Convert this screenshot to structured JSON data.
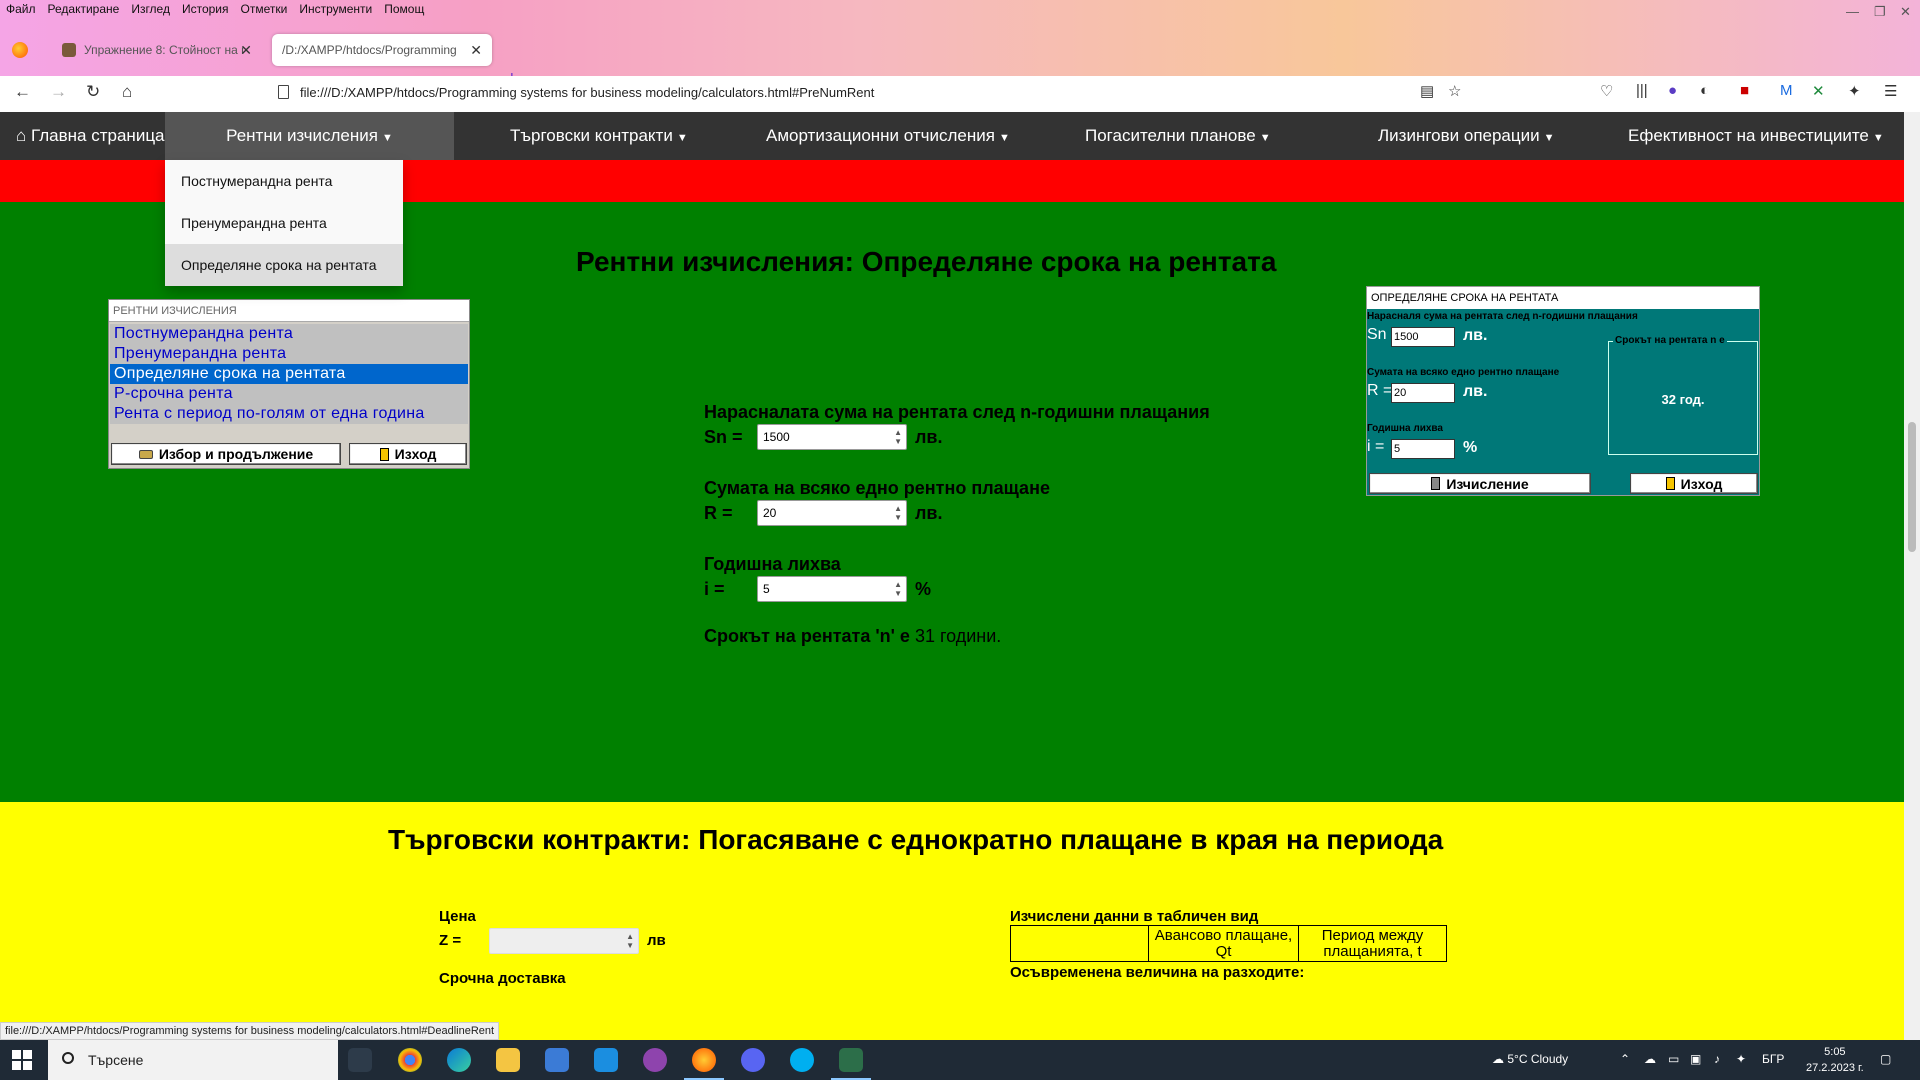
{
  "browser": {
    "menu": [
      "Файл",
      "Редактиране",
      "Изглед",
      "История",
      "Отметки",
      "Инструменти",
      "Помощ"
    ],
    "tabs": [
      {
        "title": "Упражнение 8: Стойност на п"
      },
      {
        "title": "/D:/XAMPP/htdocs/Programming"
      }
    ],
    "url": "file:///D:/XAMPP/htdocs/Programming systems for business modeling/calculators.html#PreNumRent",
    "status_link": "file:///D:/XAMPP/htdocs/Programming systems for business modeling/calculators.html#DeadlineRent"
  },
  "site_nav": {
    "home": "Главна страница",
    "items": [
      {
        "label": "Рентни изчисления"
      },
      {
        "label": "Търговски контракти"
      },
      {
        "label": "Амортизационни отчисления"
      },
      {
        "label": "Погасителни планове"
      },
      {
        "label": "Лизингови операции"
      },
      {
        "label": "Ефективност на инвестициите"
      }
    ],
    "dropdown": [
      "Постнумерандна рента",
      "Пренумерандна рента",
      "Определяне срока на рентата"
    ]
  },
  "rent_section": {
    "title": "Рентни изчисления: Определяне срока на рентата",
    "list_panel": {
      "title": "РЕНТНИ ИЗЧИСЛЕНИЯ",
      "items": [
        "Постнумерандна рента",
        "Пренумерандна рента",
        "Определяне срока на рентата",
        "Р-срочна рента",
        "Рента с период по-голям от една година"
      ],
      "selected_index": 2,
      "select_button": "Избор и продължение",
      "exit_button": "Изход"
    },
    "form": {
      "sn_label": "Нарасналата сума на рентата след n-годишни плащания",
      "sn_symbol": "Sn =",
      "sn_value": "1500",
      "sn_unit": "лв.",
      "r_label": "Сумата на всяко едно рентно плащане",
      "r_symbol": "R =",
      "r_value": "20",
      "r_unit": "лв.",
      "i_label": "Годишна лихва",
      "i_symbol": "i =",
      "i_value": "5",
      "i_unit": "%",
      "result_prefix": "Срокът на рентата 'n' е",
      "result_value": "31 години."
    },
    "teal_form": {
      "title": "ОПРЕДЕЛЯНЕ СРОКА НА РЕНТАТА",
      "sn_caption": "Нарасналя сума на рентата след n-годишни плащания",
      "sn_symbol": "Sn",
      "sn_value": "1500",
      "sn_unit": "лв.",
      "r_caption": "Сумата на всяко едно рентно плащане",
      "r_symbol": "R =",
      "r_value": "20",
      "r_unit": "лв.",
      "i_caption": "Годишна лихва",
      "i_symbol": "i =",
      "i_value": "5",
      "i_unit": "%",
      "result_caption": "Срокът на рентата n е",
      "result_value": "32 год.",
      "calc_button": "Изчисление",
      "exit_button": "Изход"
    }
  },
  "trade_section": {
    "title": "Търговски контракти: Погасяване с еднократно плащане в края на периода",
    "price_label": "Цена",
    "z_symbol": "Z =",
    "z_unit": "лв",
    "delivery_label": "Срочна доставка",
    "table_caption": "Изчислени данни в табличен вид",
    "table_headers": [
      "",
      "Авансово плащане, Qt",
      "Период между плащанията, t"
    ],
    "expense_caption": "Осъвременена величина на разходите:"
  },
  "taskbar": {
    "search": "Търсене",
    "weather": "5°C  Cloudy",
    "lang": "БГР",
    "time": "5:05",
    "date": "27.2.2023 г."
  },
  "colors": {
    "nav_bg": "#333333",
    "red_band": "#ff0000",
    "green_section": "#008000",
    "yellow_section": "#ffff00",
    "teal_form": "#007878",
    "list_selected": "#0066cc"
  }
}
